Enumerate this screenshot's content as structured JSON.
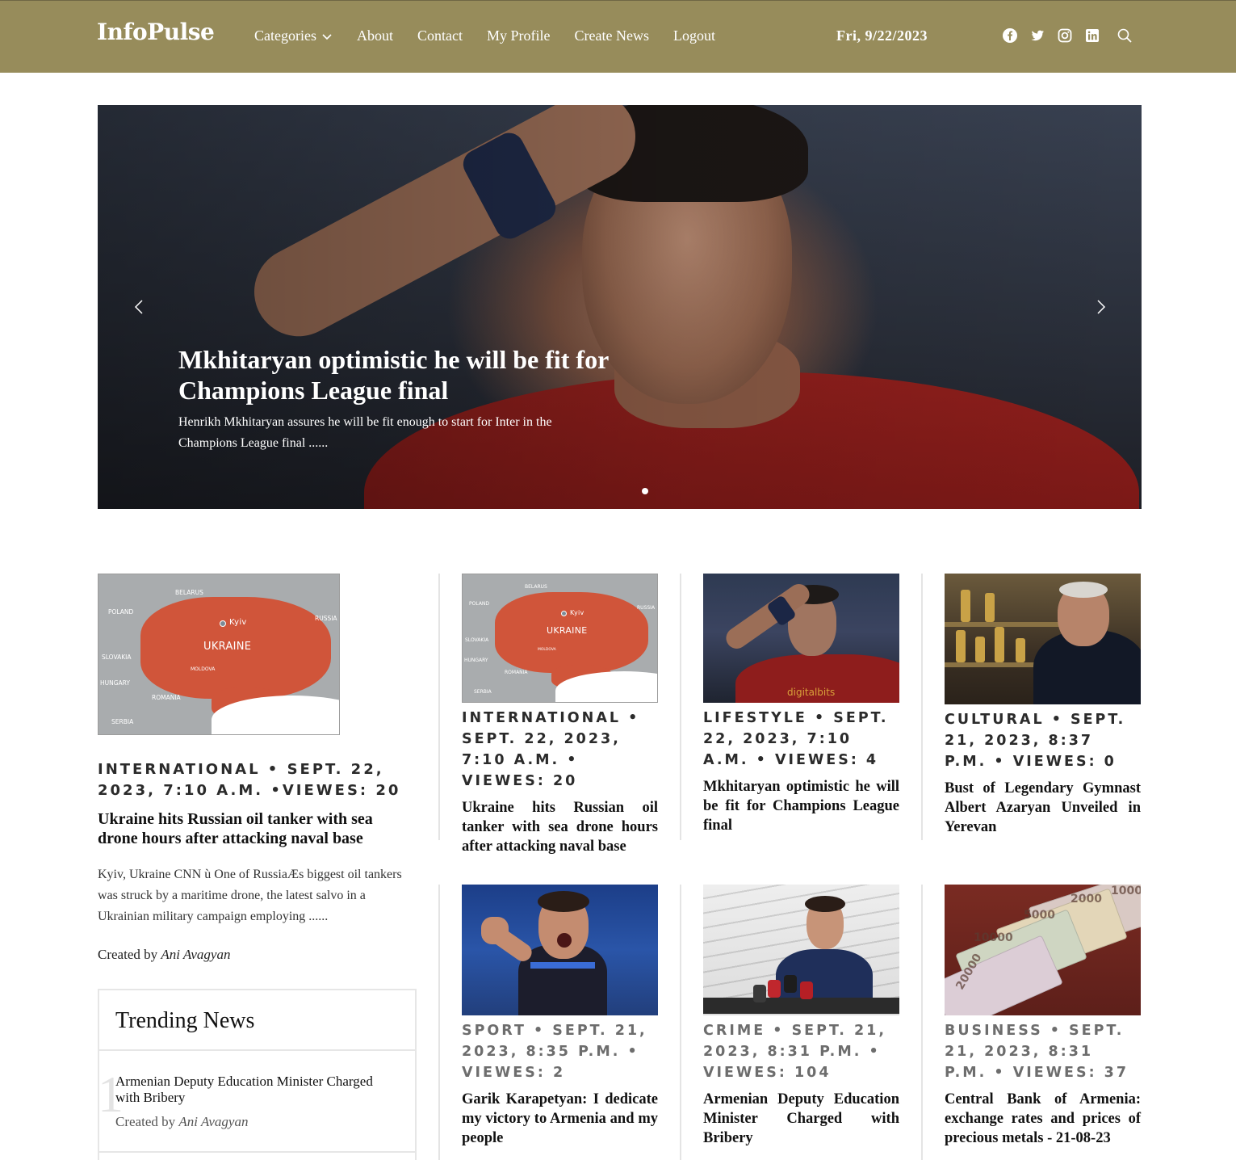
{
  "header": {
    "logo": "InfoPulse",
    "nav": [
      {
        "label": "Categories"
      },
      {
        "label": "About"
      },
      {
        "label": "Contact"
      },
      {
        "label": "My Profile"
      },
      {
        "label": "Create News"
      },
      {
        "label": "Logout"
      }
    ],
    "date": "Fri, 9/22/2023",
    "social_icons": [
      "facebook-icon",
      "twitter-icon",
      "instagram-icon",
      "linkedin-icon",
      "search-icon"
    ]
  },
  "hero": {
    "title": "Mkhitaryan optimistic he will be fit for Champions League final",
    "subtitle": "Henrikh Mkhitaryan assures he will be fit enough to start for Inter in the Champions League final ......"
  },
  "feature": {
    "map": {
      "country": "UKRAINE",
      "city": "Kyiv",
      "neighbors": [
        "BELARUS",
        "POLAND",
        "RUSSIA",
        "SLOVAKIA",
        "HUNGARY",
        "ROMANIA",
        "SERBIA",
        "MOLDOVA"
      ]
    },
    "meta": "INTERNATIONAL • SEPT. 22, 2023, 7:10 A.M. •VIEWES: 20",
    "title": "Ukraine hits Russian oil tanker with sea drone hours after attacking naval base",
    "body": "Kyiv, Ukraine CNN ù One of RussiaÆs biggest oil tankers was struck by a maritime drone, the latest salvo in a Ukrainian military campaign employing ......",
    "author_prefix": "Created by",
    "author": "Ani Avagyan"
  },
  "trending": {
    "heading": "Trending News",
    "items": [
      {
        "num": "1",
        "title": "Armenian Deputy Education Minister Charged with Bribery",
        "author_prefix": "Created by",
        "author": "Ani Avagyan"
      }
    ]
  },
  "cards": [
    {
      "meta": "INTERNATIONAL • SEPT. 22, 2023, 7:10 A.M. • VIEWES: 20",
      "title": "Ukraine hits Russian oil tanker with sea drone hours after attacking naval base"
    },
    {
      "meta": "LIFESTYLE • SEPT. 22, 2023, 7:10 A.M. • VIEWES: 4",
      "title": "Mkhitaryan optimistic he will be fit for Champions League final",
      "photo_text": "digitalbits"
    },
    {
      "meta": "CULTURAL • SEPT. 21, 2023, 8:37 P.M. • VIEWES: 0",
      "title": "Bust of Legendary Gymnast Albert Azaryan Unveiled in Yerevan"
    },
    {
      "meta": "SPORT • SEPT. 21, 2023, 8:35 P.M. • VIEWES: 2",
      "title": "Garik Karapetyan: I dedicate my victory to Armenia and my people"
    },
    {
      "meta": "CRIME • SEPT. 21, 2023, 8:31 P.M. • VIEWES: 104",
      "title": "Armenian Deputy Education Minister Charged with Bribery"
    },
    {
      "meta": "BUSINESS • SEPT. 21, 2023, 8:31 P.M. • VIEWES: 37",
      "title": "Central Bank of Armenia: exchange rates and prices of precious metals - 21-08-23",
      "photo_text": [
        "1000",
        "2000",
        "5000",
        "10000",
        "20000"
      ]
    }
  ],
  "colors": {
    "header_bg": "#978c5b",
    "accent_map": "#d0553a"
  }
}
